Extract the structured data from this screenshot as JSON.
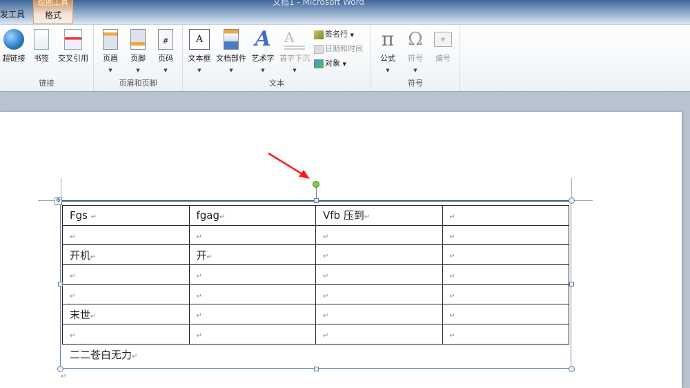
{
  "window": {
    "title": "文档1 - Microsoft Word"
  },
  "tabs": [
    {
      "label": "发工具"
    },
    {
      "label": "格式",
      "context": "绘图工具"
    }
  ],
  "ribbon": {
    "groups": [
      {
        "label": "链接",
        "buttons": [
          {
            "label": "超链接",
            "icon": "hyperlink-globe-icon"
          },
          {
            "label": "书签",
            "icon": "bookmark-icon"
          },
          {
            "label": "交叉引用",
            "icon": "cross-reference-icon"
          }
        ]
      },
      {
        "label": "页眉和页脚",
        "buttons": [
          {
            "label": "页眉",
            "icon": "header-icon"
          },
          {
            "label": "页脚",
            "icon": "footer-icon"
          },
          {
            "label": "页码",
            "icon": "page-number-icon"
          }
        ]
      },
      {
        "label": "文本",
        "buttons": [
          {
            "label": "文本框",
            "icon": "textbox-icon"
          },
          {
            "label": "文档部件",
            "icon": "quick-parts-icon"
          },
          {
            "label": "艺术字",
            "icon": "wordart-icon"
          },
          {
            "label": "首字下沉",
            "icon": "drop-cap-icon",
            "disabled": true
          }
        ],
        "small": [
          {
            "label": "签名行",
            "icon": "signature-line-icon"
          },
          {
            "label": "日期和时间",
            "icon": "date-time-icon",
            "disabled": true
          },
          {
            "label": "对象",
            "icon": "object-icon"
          }
        ]
      },
      {
        "label": "符号",
        "buttons": [
          {
            "label": "公式",
            "icon": "pi-icon"
          },
          {
            "label": "符号",
            "icon": "omega-icon",
            "disabled": true
          },
          {
            "label": "编号",
            "icon": "numbering-icon",
            "disabled": true
          }
        ]
      }
    ]
  },
  "document": {
    "table": [
      [
        "Fgs ",
        "fgag",
        "Vfb 压到",
        ""
      ],
      [
        "",
        "",
        "",
        ""
      ],
      [
        "开机",
        "开",
        "",
        ""
      ],
      [
        "",
        "",
        "",
        ""
      ],
      [
        "",
        "",
        "",
        ""
      ],
      [
        "末世",
        "",
        "",
        ""
      ],
      [
        "",
        "",
        "",
        ""
      ]
    ],
    "after_table_text": "二二苍白无力",
    "paragraph_mark": "↵"
  },
  "colors": {
    "arrow": "#ff1a1a",
    "rotate_handle": "#7ac943",
    "selection": "#6b84a6"
  }
}
